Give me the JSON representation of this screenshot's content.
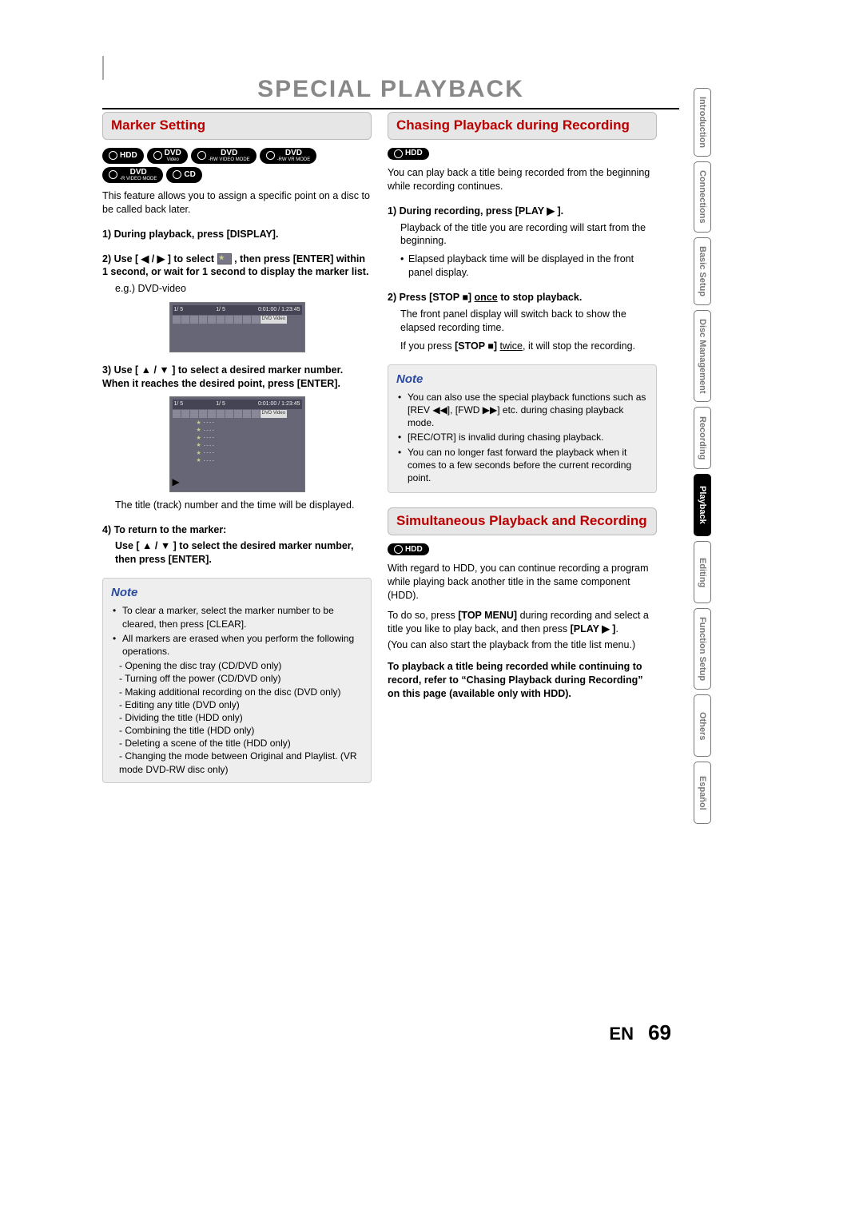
{
  "page": {
    "title": "SPECIAL PLAYBACK",
    "lang": "EN",
    "number": "69"
  },
  "side_tabs": [
    {
      "label": "Introduction",
      "active": false
    },
    {
      "label": "Connections",
      "active": false
    },
    {
      "label": "Basic Setup",
      "active": false
    },
    {
      "label": "Disc\nManagement",
      "active": false
    },
    {
      "label": "Recording",
      "active": false
    },
    {
      "label": "Playback",
      "active": true
    },
    {
      "label": "Editing",
      "active": false
    },
    {
      "label": "Function Setup",
      "active": false
    },
    {
      "label": "Others",
      "active": false
    },
    {
      "label": "Español",
      "active": false
    }
  ],
  "left": {
    "heading": "Marker Setting",
    "badges": [
      {
        "label": "HDD",
        "sub": "",
        "disc": true
      },
      {
        "label": "DVD",
        "sub": "Video",
        "disc": true
      },
      {
        "label": "DVD",
        "sub": "-RW VIDEO MODE",
        "disc": true
      },
      {
        "label": "DVD",
        "sub": "-RW VR MODE",
        "disc": true
      },
      {
        "label": "DVD",
        "sub": "-R VIDEO MODE",
        "disc": true
      },
      {
        "label": "CD",
        "sub": "",
        "disc": true
      }
    ],
    "intro": "This feature allows you to assign a specific point on a disc to be called back later.",
    "step1": "1) During playback, press [DISPLAY].",
    "step2": "2) Use [ ◀ / ▶ ] to select ",
    "step2b": " , then press [ENTER] within 1 second, or wait for 1 second to display the marker list.",
    "step2_eg": "e.g.) DVD-video",
    "shot1": {
      "bar_l": "1/  5",
      "bar_m": "1/  5",
      "bar_r": "0:01:00 / 1:23:45",
      "tag": "DVD  Video"
    },
    "step3": "3) Use [ ▲ / ▼ ] to select a desired marker number. When it reaches the desired point, press [ENTER].",
    "shot2_markers": [
      "- - - -",
      "- - - -",
      "- - - -",
      "- - - -",
      "- - - -",
      "- - - -"
    ],
    "caption3": "The title (track) number and the time will be displayed.",
    "play_symbol": "▶",
    "step4": "4) To return to the marker:",
    "step4b": "Use [ ▲ / ▼ ] to select the desired marker number, then press [ENTER].",
    "note": {
      "title": "Note",
      "items": [
        "To clear a marker, select the marker number to be cleared, then press [CLEAR].",
        "All markers are erased when you perform the following operations."
      ],
      "sublist": [
        "Opening the disc tray (CD/DVD only)",
        "Turning off the power (CD/DVD only)",
        "Making additional recording on the disc (DVD only)",
        "Editing any title (DVD only)",
        "Dividing the title (HDD only)",
        "Combining the title (HDD only)",
        "Deleting a scene of the title (HDD only)",
        "Changing the mode between Original and Playlist. (VR mode DVD-RW disc only)"
      ]
    }
  },
  "right": {
    "sec1": {
      "heading": "Chasing Playback during Recording",
      "badge": {
        "label": "HDD"
      },
      "intro": "You can play back a title being recorded from the beginning while recording continues.",
      "step1": "1) During recording, press [PLAY ▶ ].",
      "step1_body": "Playback of the title you are recording will start from the beginning.",
      "step1_bullet": "Elapsed playback time will be displayed in the front panel display.",
      "step2_a": "2) Press [STOP ■] ",
      "step2_once": "once",
      "step2_b": " to stop playback.",
      "step2_body": "The front panel display will switch back to show the elapsed recording time.",
      "step2_body2a": "If you press ",
      "step2_body2b": "[STOP ■]",
      "step2_twice": "twice",
      "step2_body2c": ", it will stop the recording.",
      "note": {
        "title": "Note",
        "items": [
          "You can also use the special playback functions such as [REV ◀◀], [FWD ▶▶] etc. during chasing playback mode.",
          "[REC/OTR] is invalid during chasing playback.",
          "You can no longer fast forward the playback when it comes to a few seconds before the current recording point."
        ]
      }
    },
    "sec2": {
      "heading": "Simultaneous Playback and Recording",
      "badge": {
        "label": "HDD"
      },
      "p1": "With regard to HDD, you can continue recording a program while playing back another title in the same component (HDD).",
      "p2a": "To do so, press ",
      "p2b": "[TOP MENU]",
      "p2c": " during recording and select a title you like to play back, and then press ",
      "p2d": "[PLAY ▶ ]",
      "p2e": ".",
      "p3": "(You can also start the playback from the title list menu.)",
      "p4": "To playback a title being recorded while continuing to record, refer to “Chasing Playback during Recording” on this page (available only with HDD)."
    }
  }
}
